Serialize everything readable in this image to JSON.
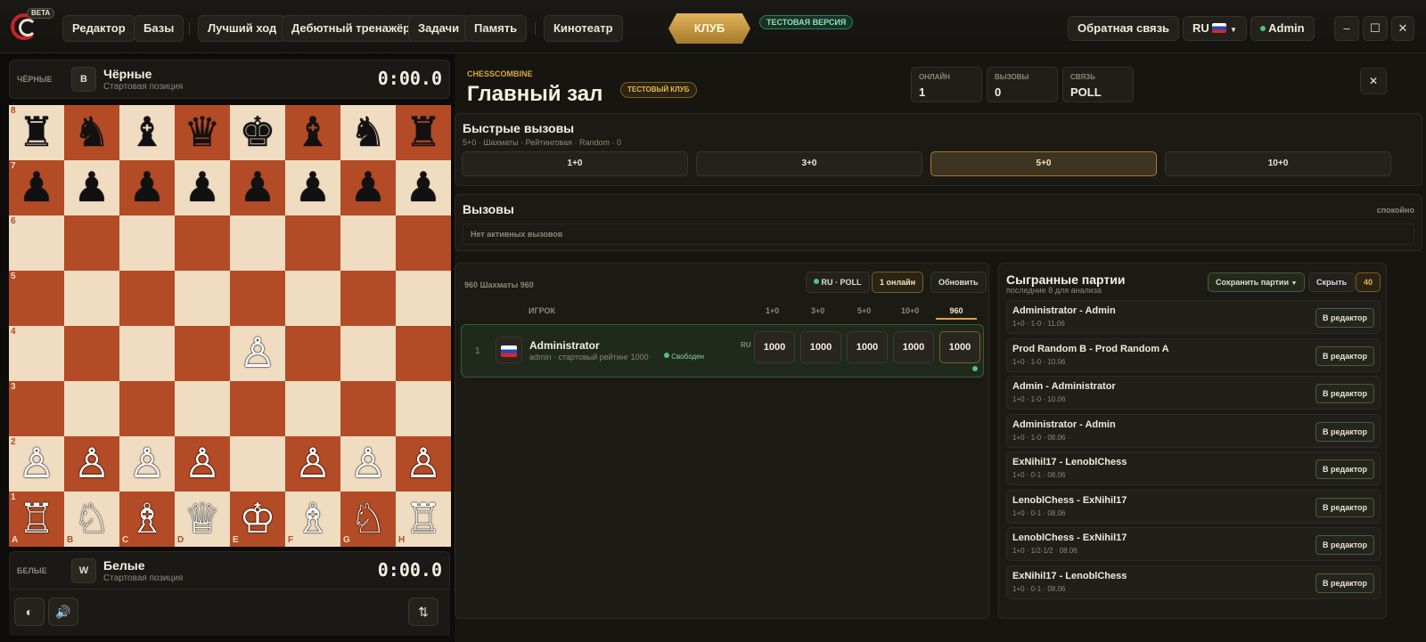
{
  "app": {
    "beta": "BETA"
  },
  "nav": {
    "editor": "Редактор",
    "bases": "Базы",
    "best_move": "Лучший ход",
    "opening": "Дебютный тренажёр",
    "tasks": "Задачи",
    "memory": "Память",
    "cinema": "Кинотеатр",
    "club": "КЛУБ",
    "test_version": "ТЕСТОВАЯ ВЕРСИЯ"
  },
  "topright": {
    "feedback": "Обратная связь",
    "lang": "RU",
    "user": "Admin"
  },
  "black": {
    "side": "ЧЁРНЫЕ",
    "badge": "B",
    "name": "Чёрные",
    "sub": "Стартовая позиция",
    "clock": "0:00.0"
  },
  "white": {
    "side": "БЕЛЫЕ",
    "badge": "W",
    "name": "Белые",
    "sub": "Стартовая позиция",
    "clock": "0:00.0"
  },
  "board": {
    "rows": [
      [
        "♜",
        "♞",
        "♝",
        "♛",
        "♚",
        "♝",
        "♞",
        "♜"
      ],
      [
        "♟",
        "♟",
        "♟",
        "♟",
        "♟",
        "♟",
        "♟",
        "♟"
      ],
      [
        "",
        "",
        "",
        "",
        "",
        "",
        "",
        ""
      ],
      [
        "",
        "",
        "",
        "",
        "",
        "",
        "",
        ""
      ],
      [
        "",
        "",
        "",
        "",
        "♙",
        "",
        "",
        ""
      ],
      [
        "",
        "",
        "",
        "",
        "",
        "",
        "",
        ""
      ],
      [
        "♙",
        "♙",
        "♙",
        "♙",
        "",
        "♙",
        "♙",
        "♙"
      ],
      [
        "♖",
        "♘",
        "♗",
        "♕",
        "♔",
        "♗",
        "♘",
        "♖"
      ]
    ],
    "ranks": [
      "8",
      "7",
      "6",
      "5",
      "4",
      "3",
      "2",
      "1"
    ],
    "files": [
      "A",
      "B",
      "C",
      "D",
      "E",
      "F",
      "G",
      "H"
    ]
  },
  "hall": {
    "brand": "CHESSCOMBINE",
    "title": "Главный зал",
    "club_tag": "ТЕСТОВЫЙ КЛУБ",
    "stats": [
      {
        "k": "ОНЛАЙН",
        "v": "1"
      },
      {
        "k": "ВЫЗОВЫ",
        "v": "0"
      },
      {
        "k": "СВЯЗЬ",
        "v": "POLL"
      }
    ]
  },
  "quick": {
    "title": "Быстрые вызовы",
    "sub": "5+0 · Шахматы · Рейтинговая · Random · 0",
    "controls": [
      "1+0",
      "3+0",
      "5+0",
      "10+0"
    ],
    "active": 2
  },
  "challenges": {
    "title": "Вызовы",
    "status": "спокойно",
    "empty": "Нет активных вызовов"
  },
  "players": {
    "mode": "960 Шахматы 960",
    "conn": "RU · POLL",
    "online": "1 онлайн",
    "refresh": "Обновить",
    "col_player": "ИГРОК",
    "cols": [
      "1+0",
      "3+0",
      "5+0",
      "10+0",
      "960"
    ],
    "rows": [
      {
        "rank": "1",
        "name": "Administrator",
        "sub": "admin · стартовый рейтинг 1000",
        "status": "Свободен",
        "country": "RU",
        "ratings": [
          "1000",
          "1000",
          "1000",
          "1000",
          "1000"
        ]
      }
    ]
  },
  "games": {
    "title": "Сыгранные партии",
    "sub": "последние 8 для анализа",
    "save": "Сохранить партии",
    "hide": "Скрыть",
    "count": "40",
    "edit": "В редактор",
    "items": [
      {
        "t": "Administrator - Admin",
        "s": "1+0 · 1-0 · 11.06"
      },
      {
        "t": "Prod Random B - Prod Random A",
        "s": "1+0 · 1-0 · 10.06"
      },
      {
        "t": "Admin - Administrator",
        "s": "1+0 · 1-0 · 10.06"
      },
      {
        "t": "Administrator - Admin",
        "s": "1+0 · 1-0 · 08.06"
      },
      {
        "t": "ExNihil17 - LenoblChess",
        "s": "1+0 · 0-1 · 08.06"
      },
      {
        "t": "LenoblChess - ExNihil17",
        "s": "1+0 · 0-1 · 08.06"
      },
      {
        "t": "LenoblChess - ExNihil17",
        "s": "1+0 · 1/2-1/2 · 08.06"
      },
      {
        "t": "ExNihil17 - LenoblChess",
        "s": "1+0 · 0-1 · 08.06"
      }
    ]
  }
}
